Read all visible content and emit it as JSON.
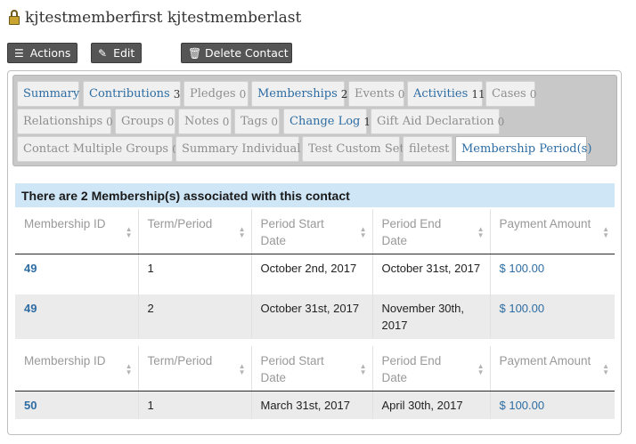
{
  "contact": {
    "name": "kjtestmemberfirst kjtestmemberlast",
    "icon": "lock-icon"
  },
  "actions": {
    "actions_label": "Actions",
    "edit_label": "Edit",
    "delete_label": "Delete Contact"
  },
  "tabs": [
    {
      "label": "Summary",
      "count": "",
      "state": "link"
    },
    {
      "label": "Contributions",
      "count": "3",
      "state": "link"
    },
    {
      "label": "Pledges",
      "count": "0",
      "state": "disabled"
    },
    {
      "label": "Memberships",
      "count": "2",
      "state": "link"
    },
    {
      "label": "Events",
      "count": "0",
      "state": "disabled"
    },
    {
      "label": "Activities",
      "count": "11",
      "state": "link"
    },
    {
      "label": "Cases",
      "count": "0",
      "state": "disabled"
    },
    {
      "label": "Relationships",
      "count": "0",
      "state": "disabled"
    },
    {
      "label": "Groups",
      "count": "0",
      "state": "disabled"
    },
    {
      "label": "Notes",
      "count": "0",
      "state": "disabled"
    },
    {
      "label": "Tags",
      "count": "0",
      "state": "disabled"
    },
    {
      "label": "Change Log",
      "count": "1",
      "state": "link"
    },
    {
      "label": "Gift Aid Declaration",
      "count": "0",
      "state": "disabled"
    },
    {
      "label": "Contact Multiple Groups",
      "count": "0",
      "state": "disabled"
    },
    {
      "label": "Summary Individual",
      "count": "",
      "state": "disabled"
    },
    {
      "label": "Test Custom Set",
      "count": "",
      "state": "disabled"
    },
    {
      "label": "filetest",
      "count": "",
      "state": "disabled"
    },
    {
      "label": "Membership Period(s)",
      "count": "",
      "state": "active"
    }
  ],
  "banner": "There are 2 Membership(s) associated with this contact",
  "columns": [
    "Membership ID",
    "Term/Period",
    "Period Start Date",
    "Period End Date",
    "Payment Amount"
  ],
  "tables": [
    {
      "rows": [
        {
          "id": "49",
          "term": "1",
          "start": "October 2nd, 2017",
          "end": "October 31st, 2017",
          "amount": "$ 100.00"
        },
        {
          "id": "49",
          "term": "2",
          "start": "October 31st, 2017",
          "end": "November 30th, 2017",
          "amount": "$ 100.00"
        }
      ]
    },
    {
      "rows": [
        {
          "id": "50",
          "term": "1",
          "start": "March 31st, 2017",
          "end": "April 30th, 2017",
          "amount": "$ 100.00"
        }
      ]
    }
  ],
  "colors": {
    "link": "#2d6da3",
    "banner": "#cfe6f7",
    "button": "#555555"
  }
}
